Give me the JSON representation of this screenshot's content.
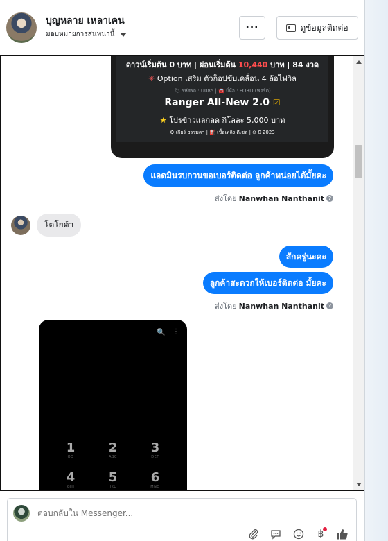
{
  "header": {
    "contact_name": "บุญหลาย เหลาเคน",
    "assign_label": "มอบหมายการสนทนานี้",
    "more_label": "···",
    "view_contact_label": "ดูข้อมูลติดต่อ"
  },
  "promo": {
    "line1_pre": "ดาวน์เริ่มต้น 0 บาท | ผ่อนเริ่มต้น ",
    "line1_price": "10,440",
    "line1_post": " บาท | 84 งวด",
    "line2_star": "✳",
    "line2": " Option เสริม ตัวก็อปขับเคลื่อน 4 ล้อไฟวิล",
    "line3": "🏷 รหัสรถ : U085 | 🚘 ยี่ห้อ : FORD (ฟอร์ด)",
    "model": "Ranger All-New 2.0",
    "model_check": "☑",
    "line5_star": "★",
    "line5": " โปรข้าวแลกลด กิโลละ 5,000 บาท",
    "line6": "⚙ เกียร์ ธรรมดา   |   ⛽ เชื้อเพลิง ดีเซล   |   ⊙ ปี 2023"
  },
  "messages": {
    "out1": "แอดมินรบกวนขอเบอร์ติดต่อ ลูกค้าหน่อยได้มั้ยคะ",
    "sent_by_label": "ส่งโดย",
    "sent_by_name": "Nanwhan Nanthanit",
    "in1": "โตโยต้า",
    "out2": "สักครู่นะคะ",
    "out3": "ลูกค้าสะดวกให้เบอร์ติดต่อ มั้ยคะ"
  },
  "phone": {
    "search_icon": "search-icon",
    "keys": [
      {
        "digit": "1",
        "letters": "QO"
      },
      {
        "digit": "2",
        "letters": "ABC"
      },
      {
        "digit": "3",
        "letters": "DEF"
      },
      {
        "digit": "4",
        "letters": "GHI"
      },
      {
        "digit": "5",
        "letters": "JKL"
      },
      {
        "digit": "6",
        "letters": "MNO"
      }
    ]
  },
  "composer": {
    "placeholder": "ตอบกลับใน Messenger..."
  },
  "colors": {
    "accent": "#0a7cff",
    "incoming_bubble": "#e9e9eb",
    "promo_price": "#ff4d4d"
  }
}
